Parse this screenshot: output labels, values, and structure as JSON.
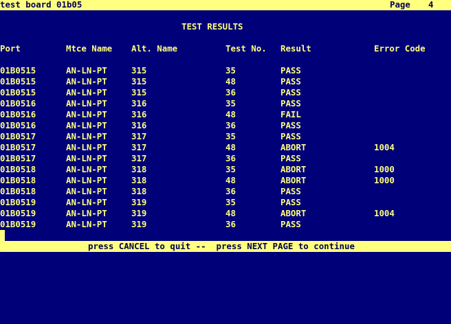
{
  "header": {
    "title": "test board 01b05",
    "page_label": "Page",
    "page_number": "4"
  },
  "screen_title": "TEST RESULTS",
  "columns": {
    "port": "Port",
    "mtce_name": "Mtce Name",
    "alt_name": "Alt. Name",
    "test_no": "Test No.",
    "result": "Result",
    "error_code": "Error Code"
  },
  "rows": [
    {
      "port": "01B0515",
      "mtce": "AN-LN-PT",
      "alt": "315",
      "test": "35",
      "result": "PASS",
      "err": ""
    },
    {
      "port": "01B0515",
      "mtce": "AN-LN-PT",
      "alt": "315",
      "test": "48",
      "result": "PASS",
      "err": ""
    },
    {
      "port": "01B0515",
      "mtce": "AN-LN-PT",
      "alt": "315",
      "test": "36",
      "result": "PASS",
      "err": ""
    },
    {
      "port": "01B0516",
      "mtce": "AN-LN-PT",
      "alt": "316",
      "test": "35",
      "result": "PASS",
      "err": ""
    },
    {
      "port": "01B0516",
      "mtce": "AN-LN-PT",
      "alt": "316",
      "test": "48",
      "result": "FAIL",
      "err": ""
    },
    {
      "port": "01B0516",
      "mtce": "AN-LN-PT",
      "alt": "316",
      "test": "36",
      "result": "PASS",
      "err": ""
    },
    {
      "port": "01B0517",
      "mtce": "AN-LN-PT",
      "alt": "317",
      "test": "35",
      "result": "PASS",
      "err": ""
    },
    {
      "port": "01B0517",
      "mtce": "AN-LN-PT",
      "alt": "317",
      "test": "48",
      "result": "ABORT",
      "err": "1004"
    },
    {
      "port": "01B0517",
      "mtce": "AN-LN-PT",
      "alt": "317",
      "test": "36",
      "result": "PASS",
      "err": ""
    },
    {
      "port": "01B0518",
      "mtce": "AN-LN-PT",
      "alt": "318",
      "test": "35",
      "result": "ABORT",
      "err": "1000"
    },
    {
      "port": "01B0518",
      "mtce": "AN-LN-PT",
      "alt": "318",
      "test": "48",
      "result": "ABORT",
      "err": "1000"
    },
    {
      "port": "01B0518",
      "mtce": "AN-LN-PT",
      "alt": "318",
      "test": "36",
      "result": "PASS",
      "err": ""
    },
    {
      "port": "01B0519",
      "mtce": "AN-LN-PT",
      "alt": "319",
      "test": "35",
      "result": "PASS",
      "err": ""
    },
    {
      "port": "01B0519",
      "mtce": "AN-LN-PT",
      "alt": "319",
      "test": "48",
      "result": "ABORT",
      "err": "1004"
    },
    {
      "port": "01B0519",
      "mtce": "AN-LN-PT",
      "alt": "319",
      "test": "36",
      "result": "PASS",
      "err": ""
    }
  ],
  "footer": {
    "message": "press CANCEL to quit --  press NEXT PAGE to continue"
  },
  "colors": {
    "background": "#000078",
    "foreground": "#ffff80",
    "bar_text": "#000050"
  }
}
